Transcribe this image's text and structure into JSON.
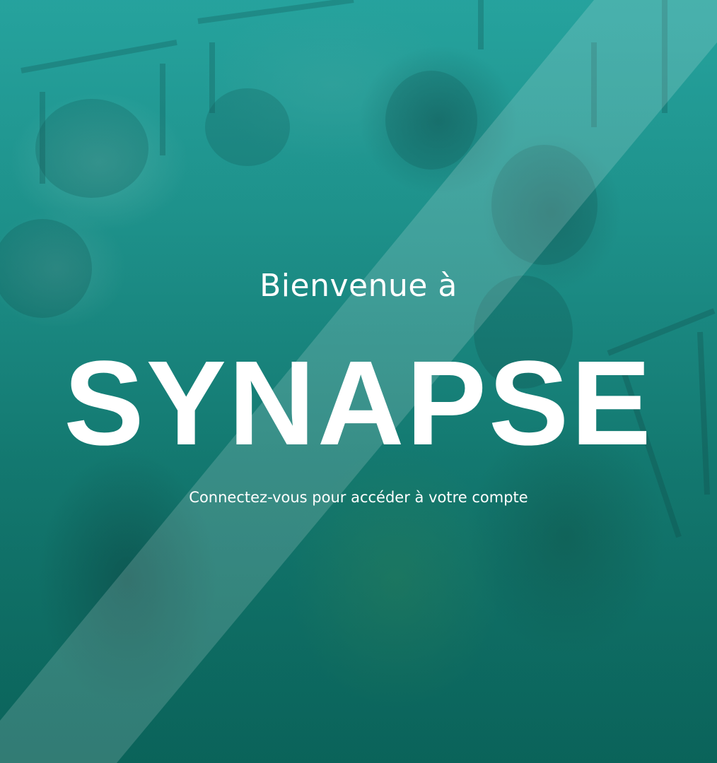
{
  "hero": {
    "welcome": "Bienvenue à",
    "brand": "SYNAPSE",
    "subtitle": "Connectez-vous pour accéder à votre compte"
  },
  "colors": {
    "overlay": "#1a9a94",
    "text": "#ffffff",
    "stripe": "rgba(255,255,255,0.18)"
  }
}
